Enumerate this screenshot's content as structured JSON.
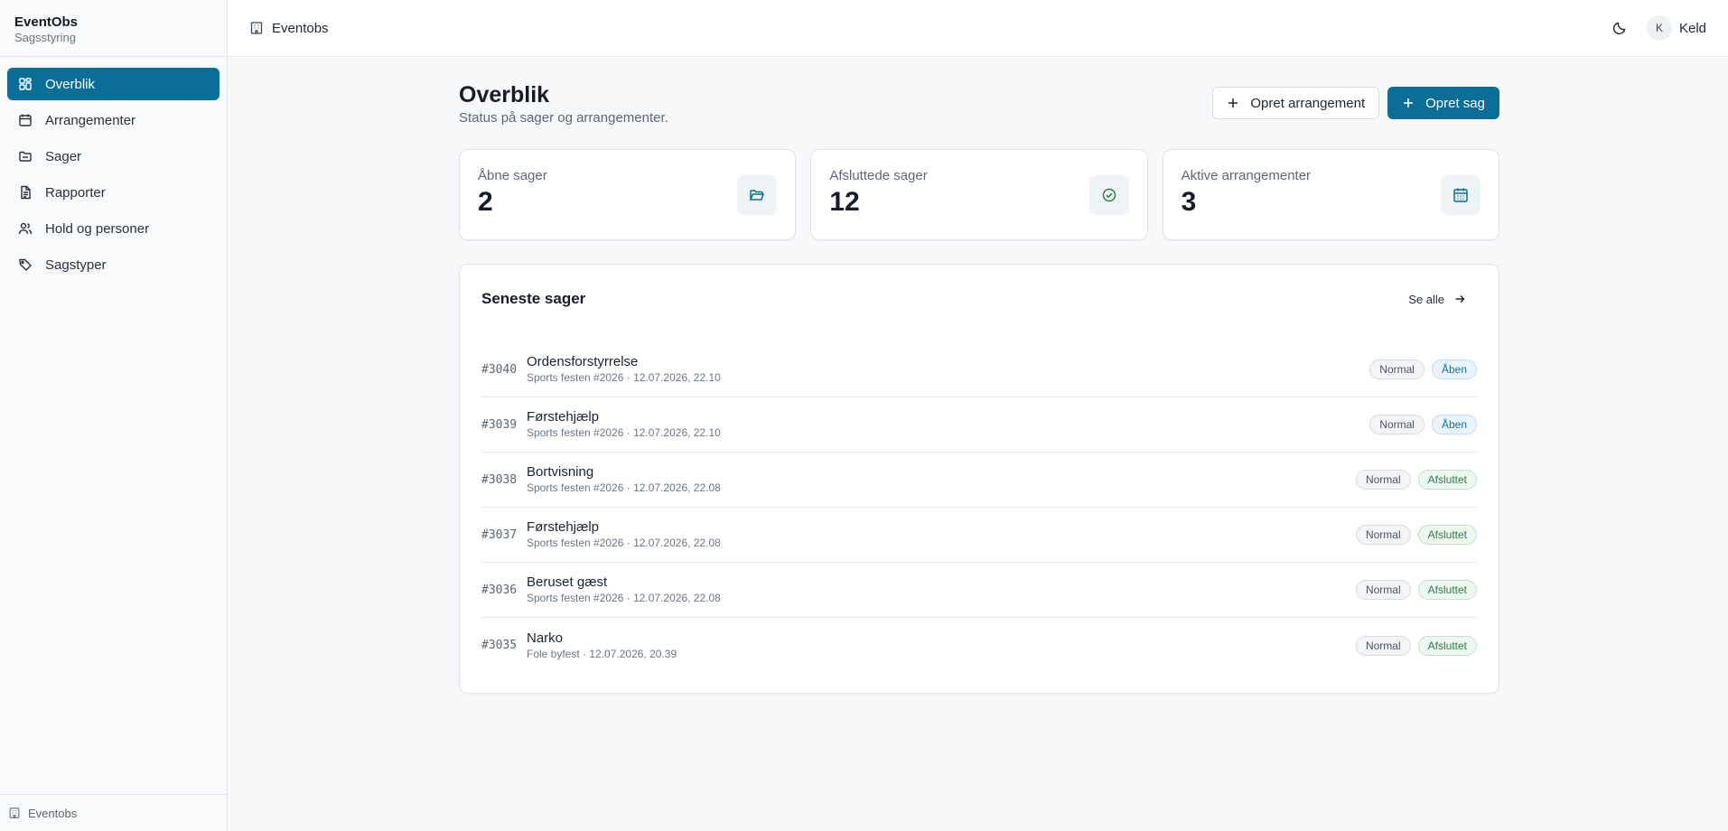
{
  "sidebar": {
    "brand_name": "EventObs",
    "brand_sub": "Sagsstyring",
    "items": [
      {
        "label": "Overblik",
        "icon": "dashboard-icon"
      },
      {
        "label": "Arrangementer",
        "icon": "calendar-icon"
      },
      {
        "label": "Sager",
        "icon": "folder-icon"
      },
      {
        "label": "Rapporter",
        "icon": "document-icon"
      },
      {
        "label": "Hold og personer",
        "icon": "users-icon"
      },
      {
        "label": "Sagstyper",
        "icon": "tag-icon"
      }
    ],
    "footer_label": "Eventobs"
  },
  "topbar": {
    "breadcrumb": "Eventobs",
    "user_initial": "K",
    "user_name": "Keld"
  },
  "main": {
    "title": "Overblik",
    "subtitle": "Status på sager og arrangementer.",
    "btn_create_event": "Opret arrangement",
    "btn_create_case": "Opret sag",
    "stats": [
      {
        "label": "Åbne sager",
        "value": "2",
        "icon": "folder-open-icon"
      },
      {
        "label": "Afsluttede sager",
        "value": "12",
        "icon": "check-circle-icon"
      },
      {
        "label": "Aktive arrangementer",
        "value": "3",
        "icon": "calendar-icon"
      }
    ],
    "recent": {
      "title": "Seneste sager",
      "see_all": "Se alle",
      "rows": [
        {
          "id": "#3040",
          "title": "Ordensforstyrrelse",
          "meta": "Sports festen #2026 · 12.07.2026, 22.10",
          "priority": "Normal",
          "status": "Åben"
        },
        {
          "id": "#3039",
          "title": "Førstehjælp",
          "meta": "Sports festen #2026 · 12.07.2026, 22.10",
          "priority": "Normal",
          "status": "Åben"
        },
        {
          "id": "#3038",
          "title": "Bortvisning",
          "meta": "Sports festen #2026 · 12.07.2026, 22.08",
          "priority": "Normal",
          "status": "Afsluttet"
        },
        {
          "id": "#3037",
          "title": "Førstehjælp",
          "meta": "Sports festen #2026 · 12.07.2026, 22.08",
          "priority": "Normal",
          "status": "Afsluttet"
        },
        {
          "id": "#3036",
          "title": "Beruset gæst",
          "meta": "Sports festen #2026 · 12.07.2026, 22.08",
          "priority": "Normal",
          "status": "Afsluttet"
        },
        {
          "id": "#3035",
          "title": "Narko",
          "meta": "Fole byfest · 12.07.2026, 20.39",
          "priority": "Normal",
          "status": "Afsluttet"
        }
      ]
    }
  },
  "colors": {
    "accent": "#0b6e96",
    "status_open": "#1a6fa8",
    "status_closed": "#2f7d47"
  }
}
